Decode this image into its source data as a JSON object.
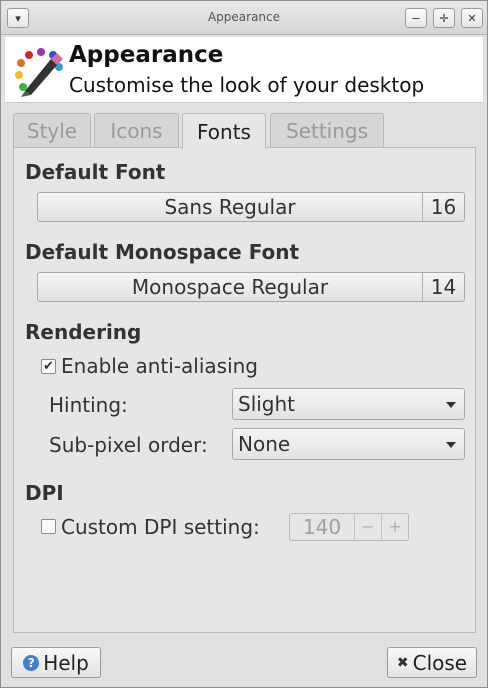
{
  "window": {
    "title": "Appearance",
    "menu_icon": "chevron-down-icon",
    "minimize_icon": "minimize-icon",
    "maximize_icon": "maximize-icon",
    "close_icon": "close-icon"
  },
  "header": {
    "icon": "paint-palette-icon",
    "title": "Appearance",
    "subtitle": "Customise the look of your desktop"
  },
  "tabs": [
    {
      "label": "Style",
      "active": false
    },
    {
      "label": "Icons",
      "active": false
    },
    {
      "label": "Fonts",
      "active": true
    },
    {
      "label": "Settings",
      "active": false
    }
  ],
  "fonts": {
    "default_heading": "Default Font",
    "default_font": "Sans Regular",
    "default_size": "16",
    "mono_heading": "Default Monospace Font",
    "mono_font": "Monospace Regular",
    "mono_size": "14"
  },
  "rendering": {
    "heading": "Rendering",
    "antialias_label": "Enable anti-aliasing",
    "antialias_checked": true,
    "hinting_label": "Hinting:",
    "hinting_value": "Slight",
    "subpixel_label": "Sub-pixel order:",
    "subpixel_value": "None"
  },
  "dpi": {
    "heading": "DPI",
    "custom_label": "Custom DPI setting:",
    "custom_checked": false,
    "value": "140",
    "decrement": "−",
    "increment": "+"
  },
  "buttons": {
    "help": "Help",
    "close": "Close"
  },
  "colors": {
    "accent": "#3e7fd0",
    "window_bg": "#e0e0e0"
  }
}
